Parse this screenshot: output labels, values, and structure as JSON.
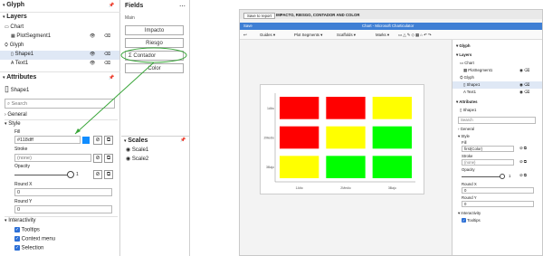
{
  "left": {
    "glyph_title": "Glyph",
    "layers_title": "Layers",
    "layers": [
      "Chart",
      "PlotSegment1",
      "Glyph",
      "Shape1",
      "Text1"
    ],
    "attributes_title": "Attributes",
    "shape_name": "Shape1",
    "search_placeholder": "Search",
    "general": "General",
    "style": "Style",
    "fill_label": "Fill",
    "fill_value": "#118dff",
    "stroke_label": "Stroke",
    "stroke_value": "(none)",
    "opacity_label": "Opacity",
    "opacity_value": "1",
    "opacity_fraction": 1,
    "roundx_label": "Round X",
    "roundx_value": "0",
    "roundy_label": "Round Y",
    "roundy_value": "0",
    "interactivity": "Interactivity",
    "tooltips": "Tooltips",
    "context_menu": "Context menu",
    "selection": "Selection"
  },
  "fields": {
    "title": "Fields",
    "group": "Main",
    "items": [
      "Impacto",
      "Riesgo",
      "Contador",
      "Color"
    ]
  },
  "scales": {
    "title": "Scales",
    "items": [
      "Scale1",
      "Scale2"
    ]
  },
  "app": {
    "tabs": [
      "Save to report",
      "IMPACTO, RIESGO, CONTADOR AND COLOR"
    ],
    "menu": "Save",
    "title": "Chart - Microsoft Charticulator",
    "toolbar": [
      "Guides",
      "Plot Segments",
      "Scaffolds",
      "Marks"
    ],
    "glyph_title": "Glyph",
    "layers_title": "Layers",
    "layers": [
      "Chart",
      "PlotSegment1",
      "Glyph",
      "Shape1",
      "Text1"
    ],
    "attributes_title": "Attributes",
    "shape_name": "Shape1",
    "search_placeholder": "Search",
    "general": "General",
    "style": "Style",
    "fill_label": "Fill",
    "fill_value": "first(Color)",
    "stroke_label": "Stroke",
    "stroke_value": "(none)",
    "opacity_label": "Opacity",
    "opacity_value": "1",
    "roundx_label": "Round X",
    "roundx_value": "0",
    "roundy_label": "Round Y",
    "roundy_value": "0",
    "interactivity": "Interactivity",
    "tooltips": "Tooltips"
  },
  "chart_data": {
    "type": "heatmap",
    "x_categories": [
      "1Alto",
      "2Medio",
      "3Bajo"
    ],
    "y_categories": [
      "1Alto",
      "2Medio",
      "3Bajo"
    ],
    "cells": [
      [
        "red",
        "red",
        "yellow"
      ],
      [
        "red",
        "yellow",
        "green"
      ],
      [
        "yellow",
        "green",
        "green"
      ]
    ]
  },
  "colors": {
    "accent": "#2b6fd6",
    "brand_bar": "#3f7fd4",
    "red": "#ff0000",
    "yellow": "#ffff00",
    "green": "#00ff00",
    "annotation": "#3aa63a"
  }
}
